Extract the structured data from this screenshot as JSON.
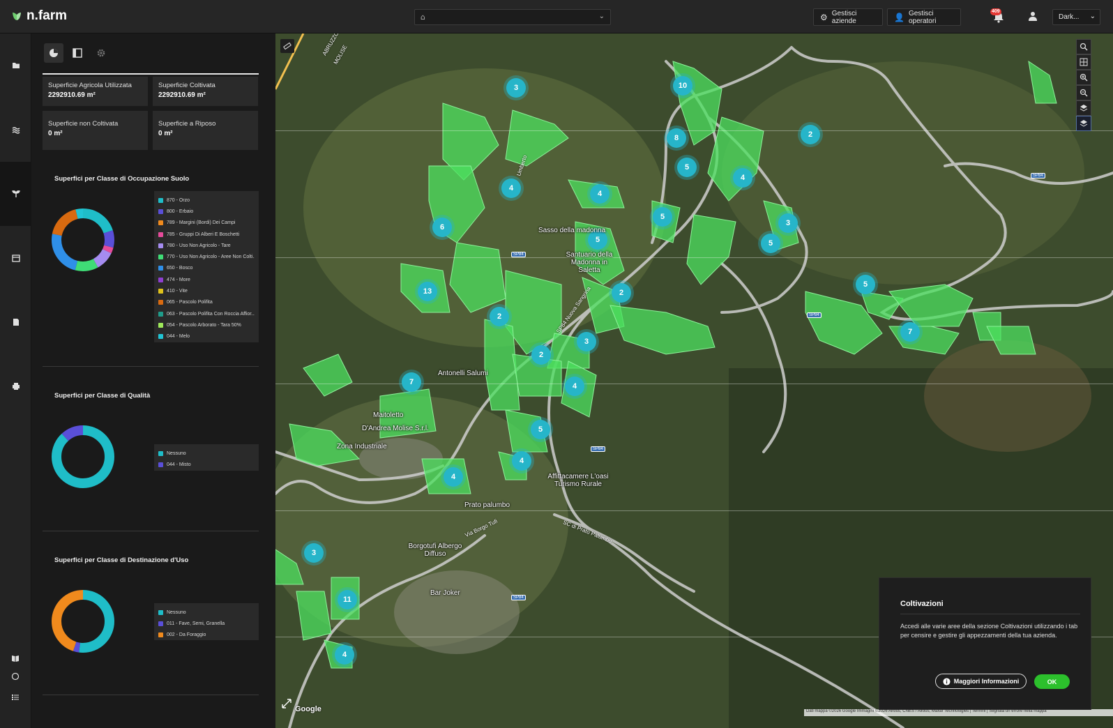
{
  "app": {
    "name": "n.farm"
  },
  "topbar": {
    "farm_select_value": "",
    "manage_farms": "Gestisci aziende",
    "manage_operators": "Gestisci operatori",
    "notification_badge": "409",
    "theme_value": "Dark..."
  },
  "cards": [
    {
      "label": "Superficie Agricola Utilizzata",
      "value": "2292910.69 m²"
    },
    {
      "label": "Superficie Coltivata",
      "value": "2292910.69 m²"
    },
    {
      "label": "Superficie non Coltivata",
      "value": "0 m²"
    },
    {
      "label": "Superficie a Riposo",
      "value": "0 m²"
    }
  ],
  "sections": {
    "occupazione": {
      "title": "Superfici per Classe di Occupazione Suolo",
      "legend": [
        {
          "label": "870 - Orzo",
          "color": "#1fbdc8"
        },
        {
          "label": "800 - Erbaio",
          "color": "#5a4fd8"
        },
        {
          "label": "789 - Margini (Bordi) Dei Campi",
          "color": "#f08a1d"
        },
        {
          "label": "785 - Gruppi Di Alberi E Boschetti",
          "color": "#e54b9a"
        },
        {
          "label": "780 - Uso Non Agricolo - Tare",
          "color": "#a58cf0"
        },
        {
          "label": "770 - Uso Non Agricolo - Aree Non Colti...",
          "color": "#3fdc76"
        },
        {
          "label": "650 - Bosco",
          "color": "#2f8fe8"
        },
        {
          "label": "474 - More",
          "color": "#8e3fd0"
        },
        {
          "label": "410 - Vite",
          "color": "#e0c21b"
        },
        {
          "label": "065 - Pascolo Polifita",
          "color": "#d86a10"
        },
        {
          "label": "063 - Pascolo Polifita Con Roccia Affior...",
          "color": "#1f9c8a"
        },
        {
          "label": "054 - Pascolo Arborato - Tara 50%",
          "color": "#9ee85a"
        },
        {
          "label": "044 - Melo",
          "color": "#21c4d4"
        }
      ],
      "slices": [
        {
          "color": "#1fbdc8",
          "value": 20
        },
        {
          "color": "#5a4fd8",
          "value": 9
        },
        {
          "color": "#e54b9a",
          "value": 3
        },
        {
          "color": "#a58cf0",
          "value": 10
        },
        {
          "color": "#3fdc76",
          "value": 12
        },
        {
          "color": "#2f8fe8",
          "value": 24
        },
        {
          "color": "#d86a10",
          "value": 18
        },
        {
          "color": "#21c4d4",
          "value": 4
        }
      ]
    },
    "qualita": {
      "title": "Superfici per Classe di Qualità",
      "legend": [
        {
          "label": "Nessuno",
          "color": "#1fbdc8"
        },
        {
          "label": "044 - Misto",
          "color": "#5a4fd8"
        }
      ],
      "slices": [
        {
          "color": "#1fbdc8",
          "value": 88
        },
        {
          "color": "#5a4fd8",
          "value": 12
        }
      ]
    },
    "destinazione": {
      "title": "Superfici per Classe di Destinazione d'Uso",
      "legend": [
        {
          "label": "Nessuno",
          "color": "#1fbdc8"
        },
        {
          "label": "011 - Fave, Semi, Granella",
          "color": "#5a4fd8"
        },
        {
          "label": "002 - Da Foraggio",
          "color": "#f08a1d"
        }
      ],
      "slices": [
        {
          "color": "#1fbdc8",
          "value": 52
        },
        {
          "color": "#5a4fd8",
          "value": 3
        },
        {
          "color": "#f08a1d",
          "value": 45
        }
      ]
    }
  },
  "map": {
    "clusters": [
      "3",
      "10",
      "2",
      "8",
      "5",
      "4",
      "4",
      "4",
      "5",
      "3",
      "5",
      "6",
      "5",
      "13",
      "2",
      "5",
      "2",
      "7",
      "3",
      "2",
      "7",
      "4",
      "5",
      "4",
      "4",
      "3",
      "11",
      "4"
    ],
    "places": [
      "Sasso della madonna",
      "Santuario della Madonna in Saletta",
      "Antonelli Salumi",
      "Maitoletto",
      "D'Andrea Molise S.r.l.",
      "Zona Industriale",
      "Affittacamere L'oasi Turismo Rurale",
      "Prato palumbo",
      "Borgotufi Albergo Diffuso",
      "Bar Joker"
    ],
    "roads": [
      "SP84 Nuova Sangrina",
      "SC di Prato Palumbo",
      "Via Borgo Tufi",
      "Umberto",
      "ABRUZZO",
      "MOLISE",
      "SP84"
    ],
    "google": "Google",
    "attribution": "Dati mappa ©2026 Google Immagini ©2026 Airbus, CNES / Airbus, Maxar Technologies  |  Termini  |  Segnala un errore nella mappa"
  },
  "popup": {
    "title": "Coltivazioni",
    "text": "Accedi alle varie aree della sezione Coltivazioni utilizzando i tab per censire e gestire gli appezzamenti della tua azienda.",
    "more_button": "Maggiori Informazioni",
    "ok_button": "OK"
  }
}
